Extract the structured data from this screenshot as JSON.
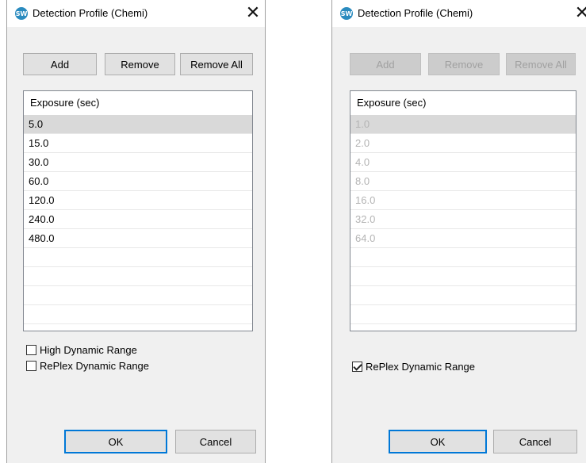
{
  "left": {
    "title": "Detection Profile (Chemi)",
    "close": "✕",
    "app_icon": "SW",
    "buttons": {
      "add": "Add",
      "remove": "Remove",
      "remove_all": "Remove All"
    },
    "list_header": "Exposure (sec)",
    "rows": [
      "5.0",
      "15.0",
      "30.0",
      "60.0",
      "120.0",
      "240.0",
      "480.0",
      "",
      "",
      "",
      ""
    ],
    "selected_row": 0,
    "checkboxes": [
      {
        "label": "High Dynamic Range",
        "checked": false
      },
      {
        "label": "RePlex Dynamic Range",
        "checked": false
      }
    ],
    "ok": "OK",
    "cancel": "Cancel"
  },
  "right": {
    "title": "Detection Profile (Chemi)",
    "close": "✕",
    "app_icon": "SW",
    "buttons": {
      "add": "Add",
      "remove": "Remove",
      "remove_all": "Remove All"
    },
    "buttons_disabled": true,
    "list_header": "Exposure (sec)",
    "rows": [
      "1.0",
      "2.0",
      "4.0",
      "8.0",
      "16.0",
      "32.0",
      "64.0",
      "",
      "",
      "",
      ""
    ],
    "selected_row": 0,
    "checkboxes": [
      {
        "label": "RePlex Dynamic Range",
        "checked": true
      }
    ],
    "ok": "OK",
    "cancel": "Cancel"
  }
}
